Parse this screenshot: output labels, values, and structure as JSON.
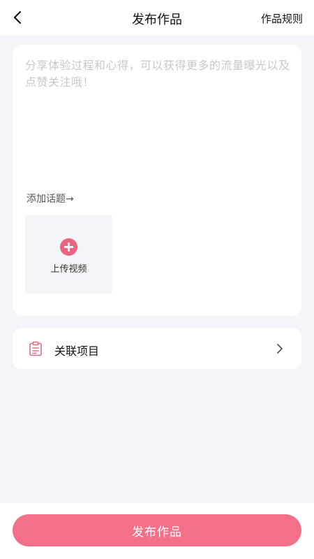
{
  "header": {
    "title": "发布作品",
    "rules_link": "作品规则"
  },
  "editor": {
    "placeholder": "分享体验过程和心得，可以获得更多的流量曝光以及点赞关注哦！",
    "topic_link": "添加话题→"
  },
  "upload": {
    "label": "上传视频"
  },
  "related": {
    "label": "关联项目"
  },
  "footer": {
    "publish_label": "发布作品"
  },
  "colors": {
    "accent": "#f27189",
    "plus": "#ea6680",
    "background": "#f3f5fa"
  }
}
